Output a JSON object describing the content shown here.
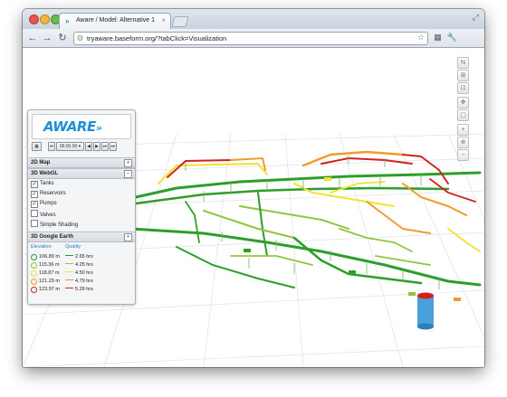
{
  "browser": {
    "tab_title": "Aware / Model: Alternative 1",
    "tab_favicon": "»",
    "tab_close": "×",
    "url": "tryaware.baseform.org/?tabClick=Visualization",
    "back_glyph": "←",
    "forward_glyph": "→",
    "reload_glyph": "↻",
    "star_glyph": "☆",
    "extension_glyph": "▦",
    "wrench_glyph": "🔧",
    "resize_glyph": "⤢"
  },
  "map_controls": [
    "N",
    "⊞",
    "⊡",
    "✥",
    "▢",
    "+",
    "⊕",
    "−"
  ],
  "panel": {
    "logo_text": "AWARE",
    "logo_arrows": "»",
    "time_value": "06:00:00",
    "time_buttons": [
      "⏮",
      "◀",
      "▶",
      "⏭",
      "⏭"
    ],
    "sections": {
      "map2d": "2D Map",
      "webgl3d": "3D WebGL",
      "earth3d": "3D Google Earth"
    },
    "layers": [
      {
        "label": "Tanks",
        "checked": true
      },
      {
        "label": "Reservoirs",
        "checked": true
      },
      {
        "label": "Pumps",
        "checked": true
      },
      {
        "label": "Valves",
        "checked": false
      },
      {
        "label": "Simple Shading",
        "checked": false
      }
    ],
    "legend": {
      "elevation_header": "Elevation",
      "quality_header": "Quality",
      "rows": [
        {
          "elevation": "106.89 m",
          "quality": "2.65 hrs",
          "color": "#2e9e2a"
        },
        {
          "elevation": "115.36 m",
          "quality": "4.25 hrs",
          "color": "#8ec63f"
        },
        {
          "elevation": "118.87 m",
          "quality": "4.50 hrs",
          "color": "#f2e230"
        },
        {
          "elevation": "121.29 m",
          "quality": "4.79 hrs",
          "color": "#f29a2e"
        },
        {
          "elevation": "123.97 m",
          "quality": "5.29 hrs",
          "color": "#d2221f"
        }
      ]
    }
  },
  "colors": {
    "accent": "#1d8fd8",
    "pipe_green": "#2e9e2a",
    "pipe_lightgreen": "#8ec63f",
    "pipe_yellow": "#f2e230",
    "pipe_orange": "#f29a2e",
    "pipe_red": "#d2221f",
    "tank_blue": "#4aa0dc"
  }
}
